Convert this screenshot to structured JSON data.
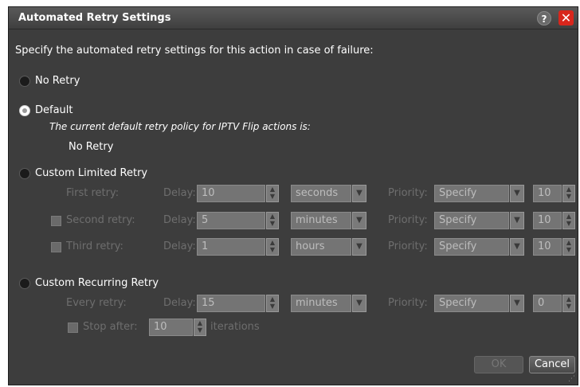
{
  "dialog": {
    "title": "Automated Retry Settings",
    "help_label": "?",
    "close_label": "✕",
    "intro": "Specify the automated retry settings for this action in case of failure:"
  },
  "options": {
    "no_retry": "No Retry",
    "default": "Default",
    "default_desc": "The current default retry policy for IPTV Flip actions is:",
    "default_value": "No Retry",
    "custom_limited": "Custom Limited Retry",
    "custom_recurring": "Custom Recurring Retry",
    "selected": "Default"
  },
  "labels": {
    "delay": "Delay:",
    "priority": "Priority:",
    "iterations": "iterations"
  },
  "limited_rows": [
    {
      "label": "First retry:",
      "delay": "10",
      "unit": "seconds",
      "priority": "Specify",
      "priority_value": "10",
      "checkbox": false
    },
    {
      "label": "Second retry:",
      "delay": "5",
      "unit": "minutes",
      "priority": "Specify",
      "priority_value": "10",
      "checkbox": true
    },
    {
      "label": "Third retry:",
      "delay": "1",
      "unit": "hours",
      "priority": "Specify",
      "priority_value": "10",
      "checkbox": true
    }
  ],
  "recurring": {
    "label": "Every retry:",
    "delay": "15",
    "unit": "minutes",
    "priority": "Specify",
    "priority_value": "0",
    "stop_after_label": "Stop after:",
    "stop_after_value": "10"
  },
  "buttons": {
    "ok": "OK",
    "cancel": "Cancel"
  }
}
